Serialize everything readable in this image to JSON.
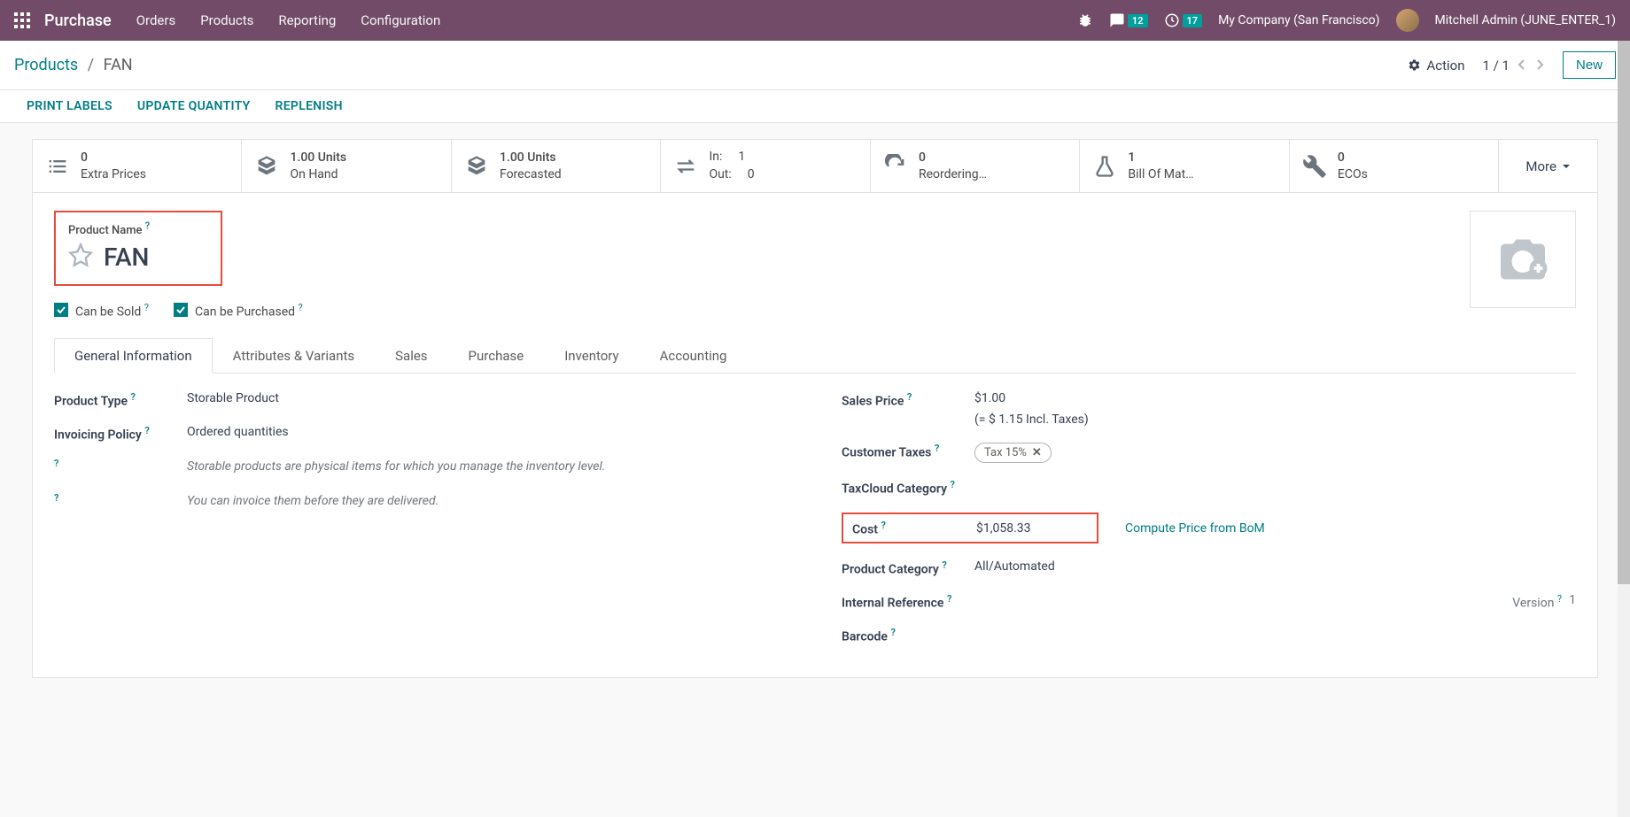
{
  "topbar": {
    "brand": "Purchase",
    "nav": [
      "Orders",
      "Products",
      "Reporting",
      "Configuration"
    ],
    "msg_badge": "12",
    "activity_badge": "17",
    "company": "My Company (San Francisco)",
    "user": "Mitchell Admin (JUNE_ENTER_1)"
  },
  "subbar": {
    "breadcrumb_root": "Products",
    "breadcrumb_current": "FAN",
    "action_label": "Action",
    "pager": "1 / 1",
    "new_label": "New"
  },
  "actionbar": {
    "print_labels": "PRINT LABELS",
    "update_qty": "UPDATE QUANTITY",
    "replenish": "REPLENISH"
  },
  "stats": {
    "extra_prices": {
      "v": "0",
      "l": "Extra Prices"
    },
    "on_hand": {
      "v": "1.00 Units",
      "l": "On Hand"
    },
    "forecasted": {
      "v": "1.00 Units",
      "l": "Forecasted"
    },
    "in_label": "In:",
    "in_val": "1",
    "out_label": "Out:",
    "out_val": "0",
    "reordering": {
      "v": "0",
      "l": "Reordering…"
    },
    "bom": {
      "v": "1",
      "l": "Bill Of Mat…"
    },
    "ecos": {
      "v": "0",
      "l": "ECOs"
    },
    "more": "More"
  },
  "product": {
    "name_label": "Product Name",
    "name": "FAN",
    "can_be_sold": "Can be Sold",
    "can_be_purchased": "Can be Purchased"
  },
  "tabs": [
    "General Information",
    "Attributes & Variants",
    "Sales",
    "Purchase",
    "Inventory",
    "Accounting"
  ],
  "form": {
    "product_type_label": "Product Type",
    "product_type": "Storable Product",
    "invoicing_policy_label": "Invoicing Policy",
    "invoicing_policy": "Ordered quantities",
    "desc1": "Storable products are physical items for which you manage the inventory level.",
    "desc2": "You can invoice them before they are delivered.",
    "sales_price_label": "Sales Price",
    "sales_price": "$1.00",
    "sales_price_incl": "(= $ 1.15 Incl. Taxes)",
    "customer_taxes_label": "Customer Taxes",
    "customer_taxes_tag": "Tax 15%",
    "taxcloud_label": "TaxCloud Category",
    "cost_label": "Cost",
    "cost": "$1,058.33",
    "compute_bom": "Compute Price from BoM",
    "category_label": "Product Category",
    "category": "All/Automated",
    "internal_ref_label": "Internal Reference",
    "barcode_label": "Barcode",
    "version_label": "Version",
    "version": "1"
  }
}
